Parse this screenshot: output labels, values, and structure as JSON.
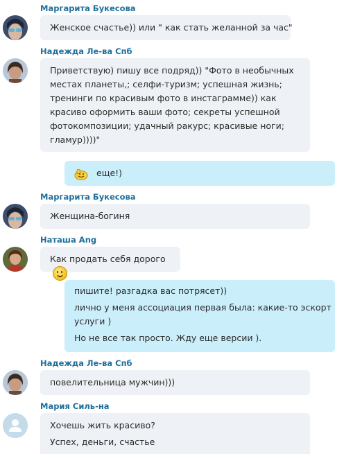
{
  "messages": [
    {
      "sender": "Маргарита Букесова",
      "lines": [
        "Женское счастье)) или \" как стать желанной за час\""
      ]
    },
    {
      "sender": "Надежда Ле-ва Спб",
      "lines": [
        "Приветствую) пишу все подряд)) \"Фото в необычных",
        "местах планеты,; селфи-туризм; успешная жизнь;",
        "тренинги по красивым фото в инстаграмме)) как",
        "красиво оформить ваши фото; секреты успешной",
        "фотокомпозиции; удачный ракурс; красивые ноги;",
        "гламур))))\""
      ]
    },
    {
      "outgoing": true,
      "emoji": "thumbs-up-emoji",
      "text": "еще!)"
    },
    {
      "sender": "Маргарита Букесова",
      "lines": [
        "Женщина-богиня"
      ]
    },
    {
      "sender": "Наташа Ang",
      "lines": [
        "Как продать себя дорого"
      ],
      "emoji": "smiley-emoji"
    },
    {
      "outgoing": true,
      "lines": [
        "пишите! разгадка вас потрясет))",
        "лично у меня ассоциация первая была: какие-то эскорт",
        "услуги )",
        "Но не все так просто. Жду еще версии )."
      ]
    },
    {
      "sender": "Надежда Ле-ва Спб",
      "lines": [
        "повелительница мужчин)))"
      ]
    },
    {
      "sender": "Мария Силь-на",
      "lines": [
        "Хочешь жить красиво?",
        "Успех, деньги, счастье"
      ]
    }
  ],
  "colors": {
    "sender_name": "#1f6f9a",
    "incoming_bubble": "#eef1f5",
    "outgoing_bubble": "#cbeefb"
  }
}
